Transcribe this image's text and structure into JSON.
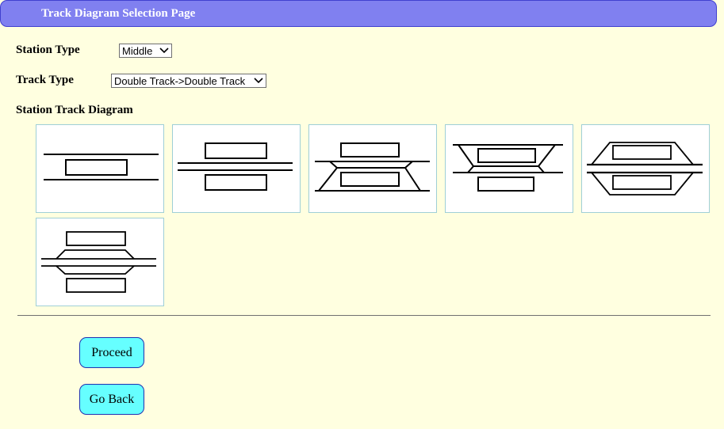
{
  "header": {
    "title": "Track Diagram Selection Page"
  },
  "form": {
    "station_type": {
      "label": "Station Type",
      "value": "Middle"
    },
    "track_type": {
      "label": "Track Type",
      "value": "Double Track->Double Track"
    },
    "diagram_section": {
      "label": "Station Track Diagram"
    }
  },
  "diagrams": [
    {
      "id": 1,
      "description": "two tracks with one island platform between"
    },
    {
      "id": 2,
      "description": "two main tracks with side platforms above and below"
    },
    {
      "id": 3,
      "description": "double track with passing loop below, platforms above and between"
    },
    {
      "id": 4,
      "description": "double track with passing loop above, platforms between and below"
    },
    {
      "id": 5,
      "description": "double main track with loops above and below, platforms in loops"
    },
    {
      "id": 6,
      "description": "double main track with short loops, outer side platforms"
    }
  ],
  "buttons": {
    "proceed": "Proceed",
    "go_back": "Go Back"
  },
  "colors": {
    "background": "#ffffe0",
    "header_bg": "#8080f0",
    "button_bg": "#66ffff",
    "diagram_border": "#9fcfd6"
  }
}
